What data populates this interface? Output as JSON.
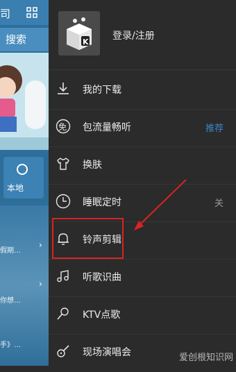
{
  "background": {
    "top_text": "司",
    "search_label": "搜索",
    "local_label": "本地",
    "list_items": [
      "假期…",
      "你想…",
      "手》…"
    ]
  },
  "drawer": {
    "login_label": "登录/注册",
    "menu": [
      {
        "label": "我的下载",
        "icon": "download-icon"
      },
      {
        "label": "包流量畅听",
        "icon": "free-badge-icon",
        "icon_text": "免",
        "right": "推荐",
        "right_color": "#3a86c8"
      },
      {
        "label": "换肤",
        "icon": "tshirt-icon"
      },
      {
        "label": "睡眠定时",
        "icon": "clock-icon",
        "right": "关",
        "right_color": "#9a9a9a"
      },
      {
        "label": "铃声剪辑",
        "icon": "bell-icon"
      },
      {
        "label": "听歌识曲",
        "icon": "music-note-icon"
      },
      {
        "label": "KTV点歌",
        "icon": "microphone-icon"
      },
      {
        "label": "现场演唱会",
        "icon": "guitar-icon"
      }
    ]
  },
  "watermark": "爱创根知识网",
  "colors": {
    "highlight": "#dd2222",
    "accent": "#3a86c8"
  }
}
